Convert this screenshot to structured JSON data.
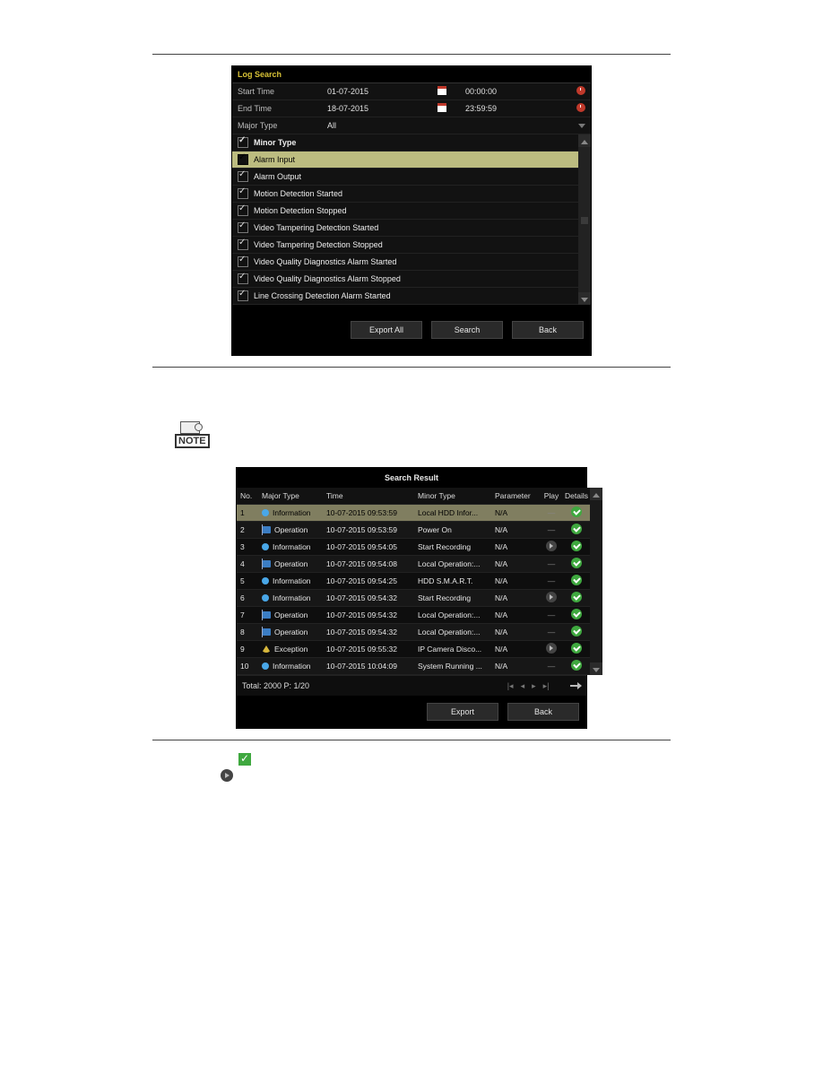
{
  "logSearch": {
    "title": "Log Search",
    "startLabel": "Start Time",
    "startDate": "01-07-2015",
    "startTime": "00:00:00",
    "endLabel": "End Time",
    "endDate": "18-07-2015",
    "endTime": "23:59:59",
    "majorTypeLabel": "Major Type",
    "majorTypeValue": "All",
    "minorTypeLabel": "Minor Type",
    "minorItems": [
      {
        "label": "Alarm Input",
        "selected": true
      },
      {
        "label": "Alarm Output",
        "selected": false
      },
      {
        "label": "Motion Detection Started",
        "selected": false
      },
      {
        "label": "Motion Detection Stopped",
        "selected": false
      },
      {
        "label": "Video Tampering Detection Started",
        "selected": false
      },
      {
        "label": "Video Tampering Detection Stopped",
        "selected": false
      },
      {
        "label": "Video Quality Diagnostics Alarm Started",
        "selected": false
      },
      {
        "label": "Video Quality Diagnostics Alarm Stopped",
        "selected": false
      },
      {
        "label": "Line Crossing Detection Alarm Started",
        "selected": false
      }
    ],
    "buttons": {
      "exportAll": "Export All",
      "search": "Search",
      "back": "Back"
    }
  },
  "searchResult": {
    "title": "Search Result",
    "cols": {
      "no": "No.",
      "major": "Major Type",
      "time": "Time",
      "minor": "Minor Type",
      "param": "Parameter",
      "play": "Play",
      "details": "Details"
    },
    "rows": [
      {
        "no": "1",
        "mtIcon": "blue",
        "major": "Information",
        "time": "10-07-2015 09:53:59",
        "minor": "Local HDD Infor...",
        "param": "N/A",
        "play": "dash",
        "hi": true
      },
      {
        "no": "2",
        "mtIcon": "flag",
        "major": "Operation",
        "time": "10-07-2015 09:53:59",
        "minor": "Power On",
        "param": "N/A",
        "play": "dash"
      },
      {
        "no": "3",
        "mtIcon": "blue",
        "major": "Information",
        "time": "10-07-2015 09:54:05",
        "minor": "Start Recording",
        "param": "N/A",
        "play": "play"
      },
      {
        "no": "4",
        "mtIcon": "flag",
        "major": "Operation",
        "time": "10-07-2015 09:54:08",
        "minor": "Local Operation:...",
        "param": "N/A",
        "play": "dash"
      },
      {
        "no": "5",
        "mtIcon": "blue",
        "major": "Information",
        "time": "10-07-2015 09:54:25",
        "minor": "HDD S.M.A.R.T.",
        "param": "N/A",
        "play": "dash"
      },
      {
        "no": "6",
        "mtIcon": "blue",
        "major": "Information",
        "time": "10-07-2015 09:54:32",
        "minor": "Start Recording",
        "param": "N/A",
        "play": "play"
      },
      {
        "no": "7",
        "mtIcon": "flag",
        "major": "Operation",
        "time": "10-07-2015 09:54:32",
        "minor": "Local Operation:...",
        "param": "N/A",
        "play": "dash"
      },
      {
        "no": "8",
        "mtIcon": "flag",
        "major": "Operation",
        "time": "10-07-2015 09:54:32",
        "minor": "Local Operation:...",
        "param": "N/A",
        "play": "dash"
      },
      {
        "no": "9",
        "mtIcon": "tri",
        "major": "Exception",
        "time": "10-07-2015 09:55:32",
        "minor": "IP Camera Disco...",
        "param": "N/A",
        "play": "play"
      },
      {
        "no": "10",
        "mtIcon": "blue",
        "major": "Information",
        "time": "10-07-2015 10:04:09",
        "minor": "System Running ...",
        "param": "N/A",
        "play": "dash"
      }
    ],
    "totalLabel": "Total: 2000  P: 1/20",
    "buttons": {
      "export": "Export",
      "back": "Back"
    }
  },
  "note": {
    "label": "NOTE"
  }
}
